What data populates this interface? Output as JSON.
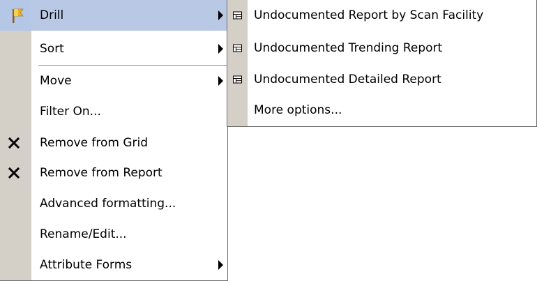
{
  "main_menu": {
    "items": [
      {
        "label": "Drill",
        "icon": "drill-flag-icon",
        "has_submenu": true,
        "highlighted": true
      },
      {
        "label": "Sort",
        "has_submenu": true
      },
      {
        "label": "Move",
        "has_submenu": true
      },
      {
        "label": "Filter On..."
      },
      {
        "label": "Remove from Grid",
        "icon": "x-icon"
      },
      {
        "label": "Remove from Report",
        "icon": "x-icon"
      },
      {
        "label": "Advanced formatting..."
      },
      {
        "label": "Rename/Edit..."
      },
      {
        "label": "Attribute Forms",
        "has_submenu": true
      }
    ]
  },
  "sub_menu": {
    "items": [
      {
        "label": "Undocumented Report by Scan Facility",
        "icon": "grid-report-icon"
      },
      {
        "label": "Undocumented Trending Report",
        "icon": "grid-report-icon"
      },
      {
        "label": "Undocumented Detailed Report",
        "icon": "grid-report-icon"
      },
      {
        "label": "More options..."
      }
    ]
  },
  "colors": {
    "gutter": "#d4d0c8",
    "highlight": "#b9c8e4",
    "border": "#6e6e6e"
  }
}
